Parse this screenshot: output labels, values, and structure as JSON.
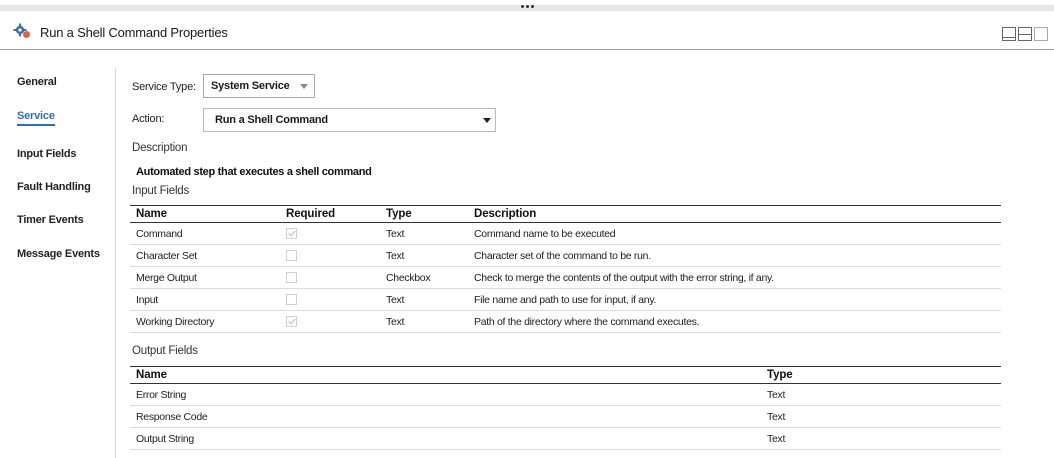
{
  "header": {
    "title": "Run a Shell Command Properties",
    "icon": "gear-icon"
  },
  "layout_buttons": [
    "layout-bottom-icon",
    "layout-split-icon",
    "layout-full-icon"
  ],
  "nav": {
    "items": [
      {
        "label": "General",
        "active": false
      },
      {
        "label": "Service",
        "active": true
      },
      {
        "label": "Input Fields",
        "active": false
      },
      {
        "label": "Fault Handling",
        "active": false
      },
      {
        "label": "Timer Events",
        "active": false
      },
      {
        "label": "Message Events",
        "active": false
      }
    ],
    "active_color": "#2f6fb6"
  },
  "service": {
    "service_type_label": "Service Type:",
    "service_type_value": "System Service",
    "action_label": "Action:",
    "action_value": "Run a Shell Command",
    "description_label": "Description",
    "description_text": "Automated step that executes a shell command"
  },
  "input_fields": {
    "title": "Input Fields",
    "columns": [
      "Name",
      "Required",
      "Type",
      "Description"
    ],
    "rows": [
      {
        "name": "Command",
        "required": true,
        "type": "Text",
        "description": "Command name to be executed"
      },
      {
        "name": "Character Set",
        "required": false,
        "type": "Text",
        "description": "Character set of the command to be run."
      },
      {
        "name": "Merge Output",
        "required": false,
        "type": "Checkbox",
        "description": "Check to merge the contents of the output with the error string, if any."
      },
      {
        "name": "Input",
        "required": false,
        "type": "Text",
        "description": "File name and path to use for input, if any."
      },
      {
        "name": "Working Directory",
        "required": true,
        "type": "Text",
        "description": "Path of the directory where the command executes."
      }
    ]
  },
  "output_fields": {
    "title": "Output Fields",
    "columns": [
      "Name",
      "Type"
    ],
    "rows": [
      {
        "name": "Error String",
        "type": "Text"
      },
      {
        "name": "Response Code",
        "type": "Text"
      },
      {
        "name": "Output String",
        "type": "Text"
      }
    ]
  }
}
